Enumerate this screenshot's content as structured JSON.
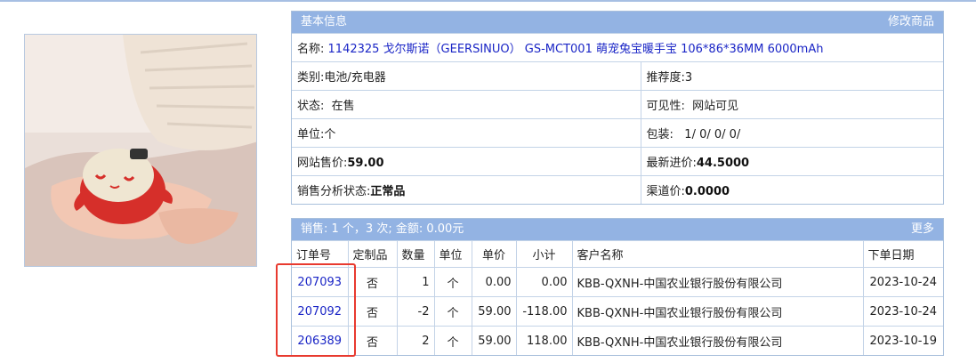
{
  "info": {
    "header_title": "基本信息",
    "edit_label": "修改商品",
    "name_label": "名称:",
    "name_value": "1142325 戈尔斯诺（GEERSINUO） GS-MCT001 萌宠兔宝暖手宝 106*86*36MM 6000mAh",
    "category_label": "类别:",
    "category_value": "电池/充电器",
    "recommend_label": "推荐度:",
    "recommend_value": "3",
    "status_label": "状态:",
    "status_value": "在售",
    "visibility_label": "可见性:",
    "visibility_value": "网站可见",
    "unit_label": "单位:",
    "unit_value": "个",
    "package_label": "包装:",
    "package_value": "1/ 0/ 0/ 0/",
    "web_price_label": "网站售价:",
    "web_price_value": "59.00",
    "latest_cost_label": "最新进价:",
    "latest_cost_value": "44.5000",
    "sales_status_label": "销售分析状态:",
    "sales_status_value": "正常品",
    "channel_price_label": "渠道价:",
    "channel_price_value": "0.0000"
  },
  "sales": {
    "summary": "销售: 1 个，3 次; 金额: 0.00元",
    "more_label": "更多",
    "columns": [
      "订单号",
      "定制品",
      "数量",
      "单位",
      "单价",
      "小计",
      "客户名称",
      "下单日期"
    ],
    "rows": [
      {
        "order_no": "207093",
        "custom": "否",
        "qty": "1",
        "unit": "个",
        "price": "0.00",
        "subtotal": "0.00",
        "customer": "KBB-QXNH-中国农业银行股份有限公司",
        "date": "2023-10-24"
      },
      {
        "order_no": "207092",
        "custom": "否",
        "qty": "-2",
        "unit": "个",
        "price": "59.00",
        "subtotal": "-118.00",
        "customer": "KBB-QXNH-中国农业银行股份有限公司",
        "date": "2023-10-24"
      },
      {
        "order_no": "206389",
        "custom": "否",
        "qty": "2",
        "unit": "个",
        "price": "59.00",
        "subtotal": "118.00",
        "customer": "KBB-QXNH-中国农业银行股份有限公司",
        "date": "2023-10-19"
      }
    ]
  },
  "colors": {
    "header_bg": "#93b3e3",
    "link": "#1a25c6",
    "highlight": "#e83a2f"
  }
}
